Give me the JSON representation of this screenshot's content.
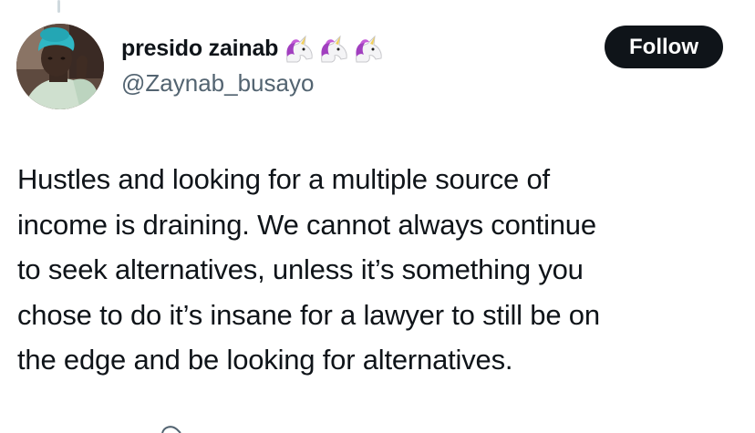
{
  "tweet": {
    "author": {
      "display_name": "presido zainab",
      "name_emojis": [
        "unicorn-emoji",
        "unicorn-emoji",
        "unicorn-emoji"
      ],
      "handle": "@Zaynab_busayo"
    },
    "follow_label": "Follow",
    "text": "Hustles and looking for a multiple source of\nincome is draining. We cannot always continue\nto seek alternatives, unless it’s something you\nchose to do it’s insane for a lawyer to still be on\nthe edge and be looking for alternatives."
  },
  "colors": {
    "text_primary": "#0f1419",
    "text_secondary": "#536471",
    "follow_bg": "#0f1419",
    "follow_text": "#ffffff",
    "thread_line": "#cfd9de"
  }
}
